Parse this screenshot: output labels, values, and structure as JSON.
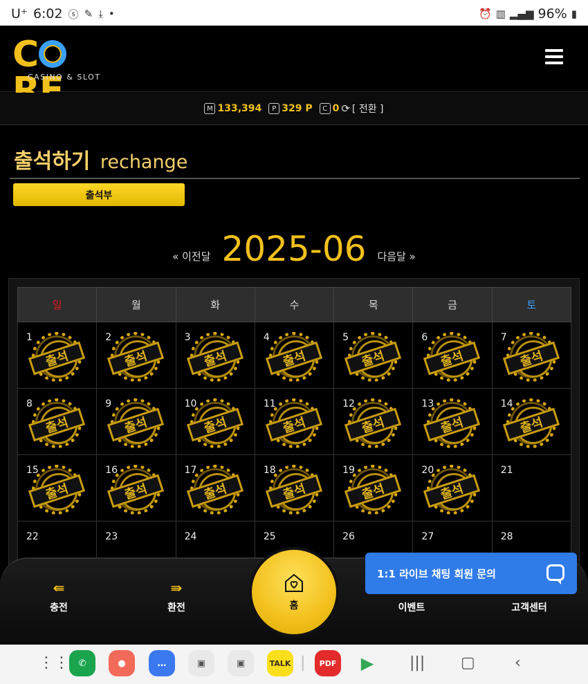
{
  "status_bar": {
    "carrier": "U⁺",
    "time": "6:02",
    "battery": "96%",
    "icons": [
      "sy-icon",
      "edit-icon",
      "download-icon",
      "dot-icon",
      "alarm-icon",
      "5g-icon",
      "signal-icon",
      "battery-icon"
    ]
  },
  "header": {
    "logo_text": "CORE",
    "logo_sub": "CASINO & SLOT",
    "menu_icon": "hamburger-icon"
  },
  "balance": {
    "money_icon": "M",
    "money": "133,394",
    "point_icon": "P",
    "points": "329 P",
    "coin_icon": "C",
    "coins": "0",
    "convert_label": "[ 전환 ]"
  },
  "page": {
    "title": "출석하기",
    "title_en": "rechange",
    "tab_label": "출석부"
  },
  "calendar": {
    "prev_label": "« 이전달",
    "month": "2025-06",
    "next_label": "다음달 »",
    "weekdays": [
      "일",
      "월",
      "화",
      "수",
      "목",
      "금",
      "토"
    ],
    "stamp_label": "출석",
    "weeks": [
      [
        {
          "day": "1",
          "attended": true
        },
        {
          "day": "2",
          "attended": true
        },
        {
          "day": "3",
          "attended": true
        },
        {
          "day": "4",
          "attended": true
        },
        {
          "day": "5",
          "attended": true
        },
        {
          "day": "6",
          "attended": true
        },
        {
          "day": "7",
          "attended": true
        }
      ],
      [
        {
          "day": "8",
          "attended": true
        },
        {
          "day": "9",
          "attended": true
        },
        {
          "day": "10",
          "attended": true
        },
        {
          "day": "11",
          "attended": true
        },
        {
          "day": "12",
          "attended": true
        },
        {
          "day": "13",
          "attended": true
        },
        {
          "day": "14",
          "attended": true
        }
      ],
      [
        {
          "day": "15",
          "attended": true
        },
        {
          "day": "16",
          "attended": true
        },
        {
          "day": "17",
          "attended": true
        },
        {
          "day": "18",
          "attended": true
        },
        {
          "day": "19",
          "attended": true
        },
        {
          "day": "20",
          "attended": true
        },
        {
          "day": "21",
          "attended": false
        }
      ],
      [
        {
          "day": "22",
          "attended": false
        },
        {
          "day": "23",
          "attended": false
        },
        {
          "day": "24",
          "attended": false
        },
        {
          "day": "25",
          "attended": false
        },
        {
          "day": "26",
          "attended": false
        },
        {
          "day": "27",
          "attended": false
        },
        {
          "day": "28",
          "attended": false
        }
      ]
    ]
  },
  "bottom_nav": {
    "deposit": "충전",
    "withdraw": "환전",
    "home": "홈",
    "event": "이벤트",
    "support": "고객센터"
  },
  "chat": {
    "label": "1:1 라이브 채팅 회원 문의"
  },
  "dock": {
    "talk_label": "TALK",
    "pdf_label": "PDF"
  },
  "colors": {
    "accent": "#f2c01c",
    "sunday": "#e01b1b",
    "saturday": "#3ea1ff",
    "chat": "#2f7be8"
  }
}
